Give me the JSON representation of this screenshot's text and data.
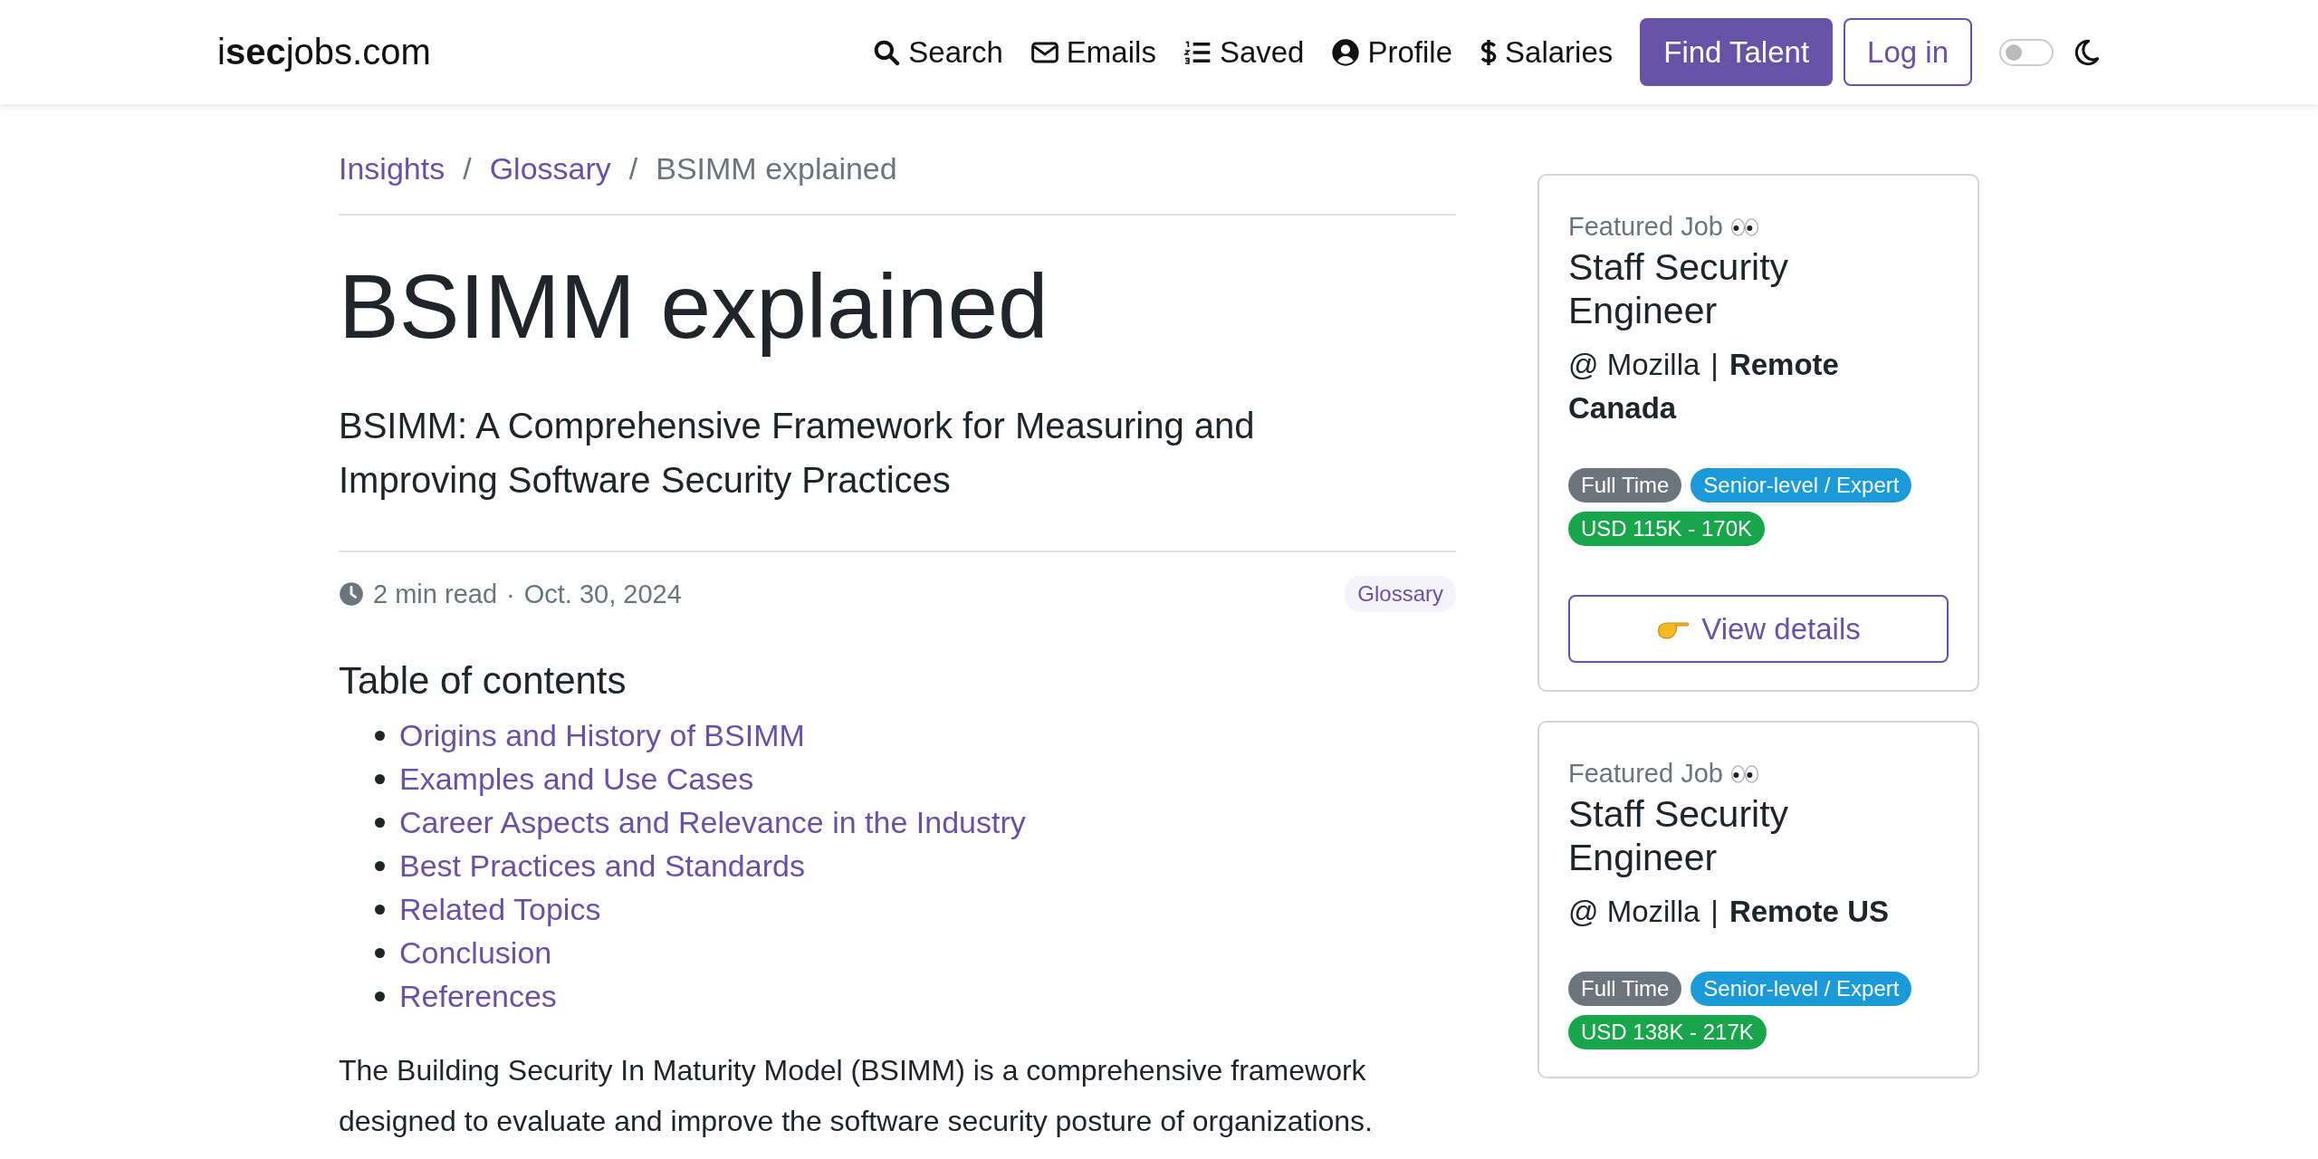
{
  "nav": {
    "logo": "i**sec**jobs.com",
    "links": [
      {
        "label": "Search"
      },
      {
        "label": "Emails"
      },
      {
        "label": "Saved"
      },
      {
        "label": "Profile"
      },
      {
        "label": "Salaries"
      }
    ],
    "primary_button": "Find Talent",
    "login_button": "Log in",
    "dark_mode": {
      "on": false
    }
  },
  "breadcrumb_separator": "/",
  "breadcrumb": [
    {
      "label": "Insights",
      "current": false
    },
    {
      "label": "Glossary",
      "current": false
    },
    {
      "label": "BSIMM explained",
      "current": true
    }
  ],
  "article": {
    "title": "BSIMM explained",
    "subtitle": "BSIMM: A Comprehensive Framework for Measuring and Improving Software Security Practices",
    "read_time": "2 min read",
    "separator": "·",
    "date": "Oct. 30, 2024",
    "category": "Glossary",
    "toc_heading": "Table of contents",
    "toc": [
      "Origins and History of BSIMM",
      "Examples and Use Cases",
      "Career Aspects and Relevance in the Industry",
      "Best Practices and Standards",
      "Related Topics",
      "Conclusion",
      "References"
    ],
    "paragraph": "The Building Security In Maturity Model (BSIMM) is a comprehensive framework designed to evaluate and improve the software security posture of organizations."
  },
  "featured_jobs": [
    {
      "label": "Featured Job",
      "title": "Staff Security Engineer",
      "company": "@ Mozilla",
      "separator": "|",
      "location": "Remote Canada",
      "tags": [
        {
          "text": "Full Time",
          "color": "#6c757d"
        },
        {
          "text": "Senior-level / Expert",
          "color": "#1a9bd7"
        },
        {
          "text": "USD 115K - 170K",
          "color": "#18a54c"
        }
      ],
      "button": "View details"
    },
    {
      "label": "Featured Job",
      "title": "Staff Security Engineer",
      "company": "@ Mozilla",
      "separator": "|",
      "location": "Remote US",
      "tags": [
        {
          "text": "Full Time",
          "color": "#6c757d"
        },
        {
          "text": "Senior-level / Expert",
          "color": "#1a9bd7"
        },
        {
          "text": "USD 138K - 217K",
          "color": "#18a54c"
        }
      ]
    }
  ]
}
